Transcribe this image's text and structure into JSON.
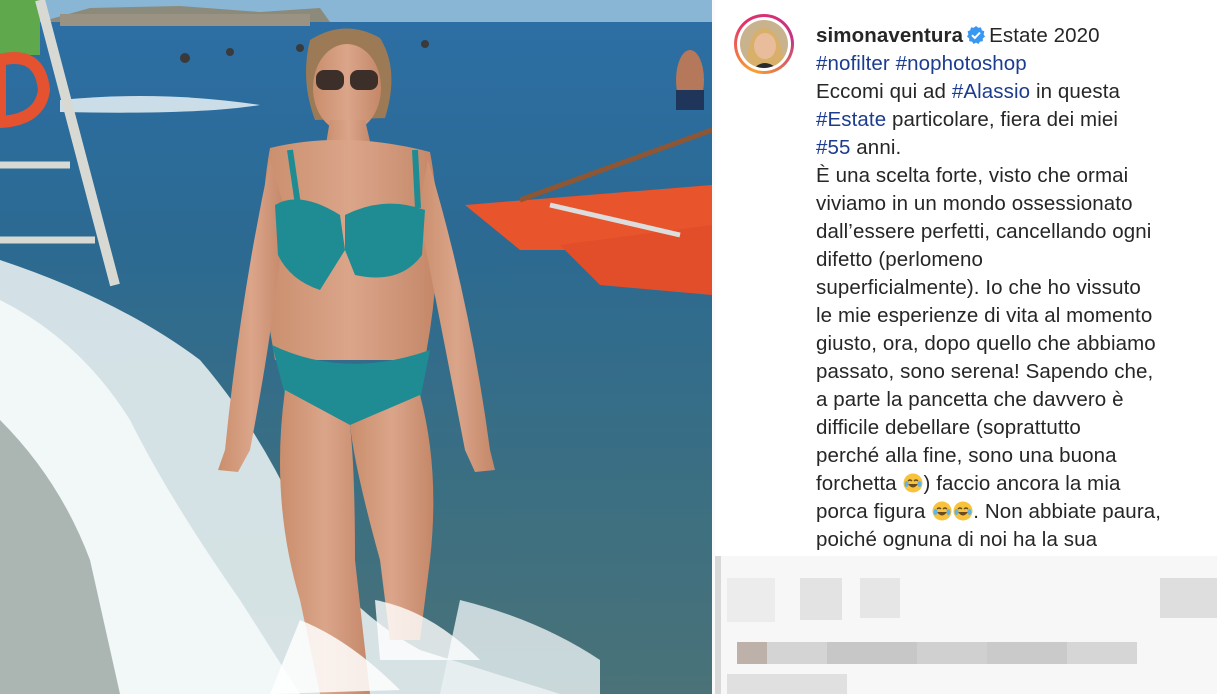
{
  "post": {
    "username": "simonaventura",
    "verified": true,
    "title_after_user": "Estate 2020",
    "line2_hashtags": [
      "#nofilter",
      "#nophotoshop"
    ],
    "l3_a": "Eccomi qui ad ",
    "l3_tag": "#Alassio",
    "l3_b": " in questa",
    "l4_tag": "#Estate",
    "l4_b": " particolare, fiera dei miei",
    "l5_tag": "#55",
    "l5_b": " anni.",
    "lines": [
      "È una scelta forte, visto che ormai",
      "viviamo in un mondo ossessionato",
      "dall’essere perfetti, cancellando ogni",
      "difetto (perlomeno",
      "superficialmente). Io che ho vissuto",
      "le mie esperienze di vita al momento",
      "giusto, ora, dopo quello che abbiamo",
      "passato, sono serena! Sapendo che,",
      "a parte la pancetta che davvero è",
      "difficile debellare (soprattutto",
      "perché alla fine, sono una buona"
    ],
    "l17_a": "forchetta ",
    "l17_b": ") faccio ancora la mia",
    "l18_a": "porca figura ",
    "l18_b": ". Non abbiate paura,",
    "l19": "poiché ognuna di noi ha la sua"
  },
  "icons": {
    "verified": "verified-badge-icon",
    "emoji": "face-with-tears-of-joy-icon"
  },
  "colors": {
    "hashtag": "#1b3c8f",
    "text": "#262626",
    "verified": "#3897f0",
    "swimsuit": "#1f8c93"
  }
}
